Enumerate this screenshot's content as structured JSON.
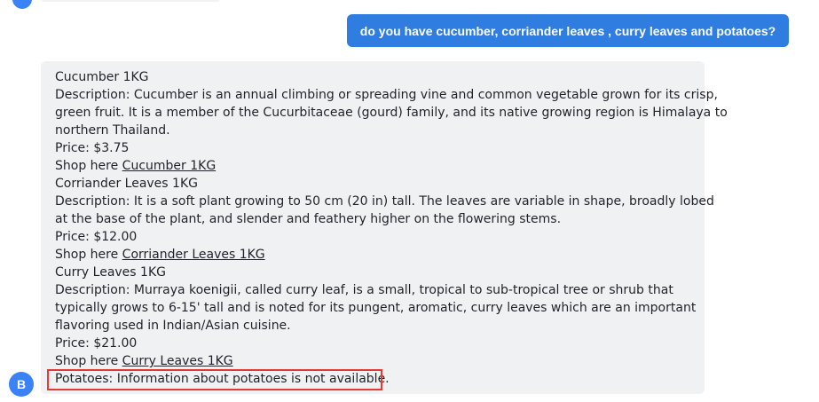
{
  "user_message": "do you have cucumber, corriander leaves , curry leaves and potatoes?",
  "bot_avatar_letter": "B",
  "bot_response": {
    "cucumber": {
      "title": "Cucumber 1KG",
      "description_lines": [
        "Description: Cucumber is an annual climbing or spreading vine and common vegetable grown for its crisp,",
        "green fruit. It is a member of the Cucurbitaceae (gourd) family, and its native growing region is Himalaya to",
        "northern Thailand."
      ],
      "price": "Price: $3.75",
      "shop_prefix": "Shop here",
      "link_text": "Cucumber 1KG"
    },
    "corriander": {
      "title": "Corriander Leaves 1KG",
      "description_lines": [
        "Description: It is a soft plant growing to 50 cm (20 in) tall. The leaves are variable in shape, broadly lobed",
        "at the base of the plant, and slender and feathery higher on the flowering stems."
      ],
      "price": "Price: $12.00",
      "shop_prefix": "Shop here",
      "link_text": "Corriander Leaves 1KG"
    },
    "curry": {
      "title": "Curry Leaves 1KG",
      "description_lines": [
        "Description: Murraya koenigii, called curry leaf, is a small, tropical to sub-tropical tree or shrub that",
        "typically grows to 6-15' tall and is noted for its pungent, aromatic, curry leaves which are an important",
        "flavoring used in Indian/Asian cuisine."
      ],
      "price": "Price: $21.00",
      "shop_prefix": "Shop here",
      "link_text": "Curry Leaves 1KG"
    },
    "potatoes_note": "Potatoes: Information about potatoes is not available."
  },
  "colors": {
    "user_bubble": "#2f7de1",
    "bot_bubble": "#f0f1f3",
    "avatar": "#3b82f6",
    "highlight": "#e53935"
  }
}
